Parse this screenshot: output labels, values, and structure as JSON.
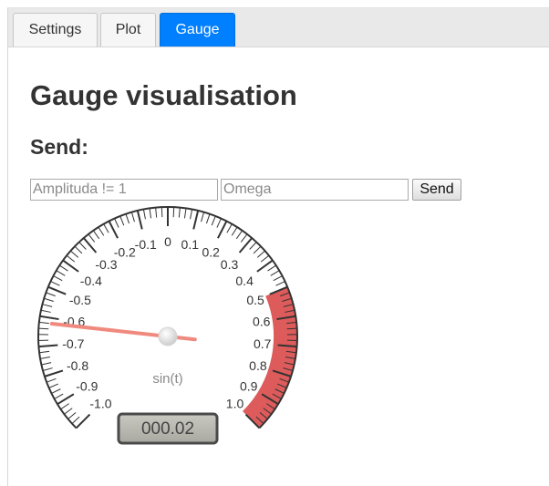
{
  "tabs": [
    {
      "label": "Settings",
      "active": false
    },
    {
      "label": "Plot",
      "active": false
    },
    {
      "label": "Gauge",
      "active": true
    }
  ],
  "page": {
    "title": "Gauge visualisation",
    "send_heading": "Send:"
  },
  "form": {
    "amplitude_placeholder": "Amplituda != 1",
    "omega_placeholder": "Omega",
    "send_label": "Send"
  },
  "gauge": {
    "title": "sin(t)",
    "min": -1.0,
    "max": 1.0,
    "value": 0.02,
    "needle_value": -0.62,
    "readout": "000.02",
    "tick_labels": [
      "-1.0",
      "-0.9",
      "-0.8",
      "-0.7",
      "-0.6",
      "-0.5",
      "-0.4",
      "-0.3",
      "-0.2",
      "-0.1",
      "0",
      "0.1",
      "0.2",
      "0.3",
      "0.4",
      "0.5",
      "0.6",
      "0.7",
      "0.8",
      "0.9",
      "1.0"
    ],
    "highlight": {
      "from": 0.5,
      "to": 1.0,
      "color": "#dd5b5b"
    },
    "colors": {
      "needle": "#f08a7e",
      "ring": "#333333",
      "readout_bg": "#b8b8b0"
    }
  }
}
